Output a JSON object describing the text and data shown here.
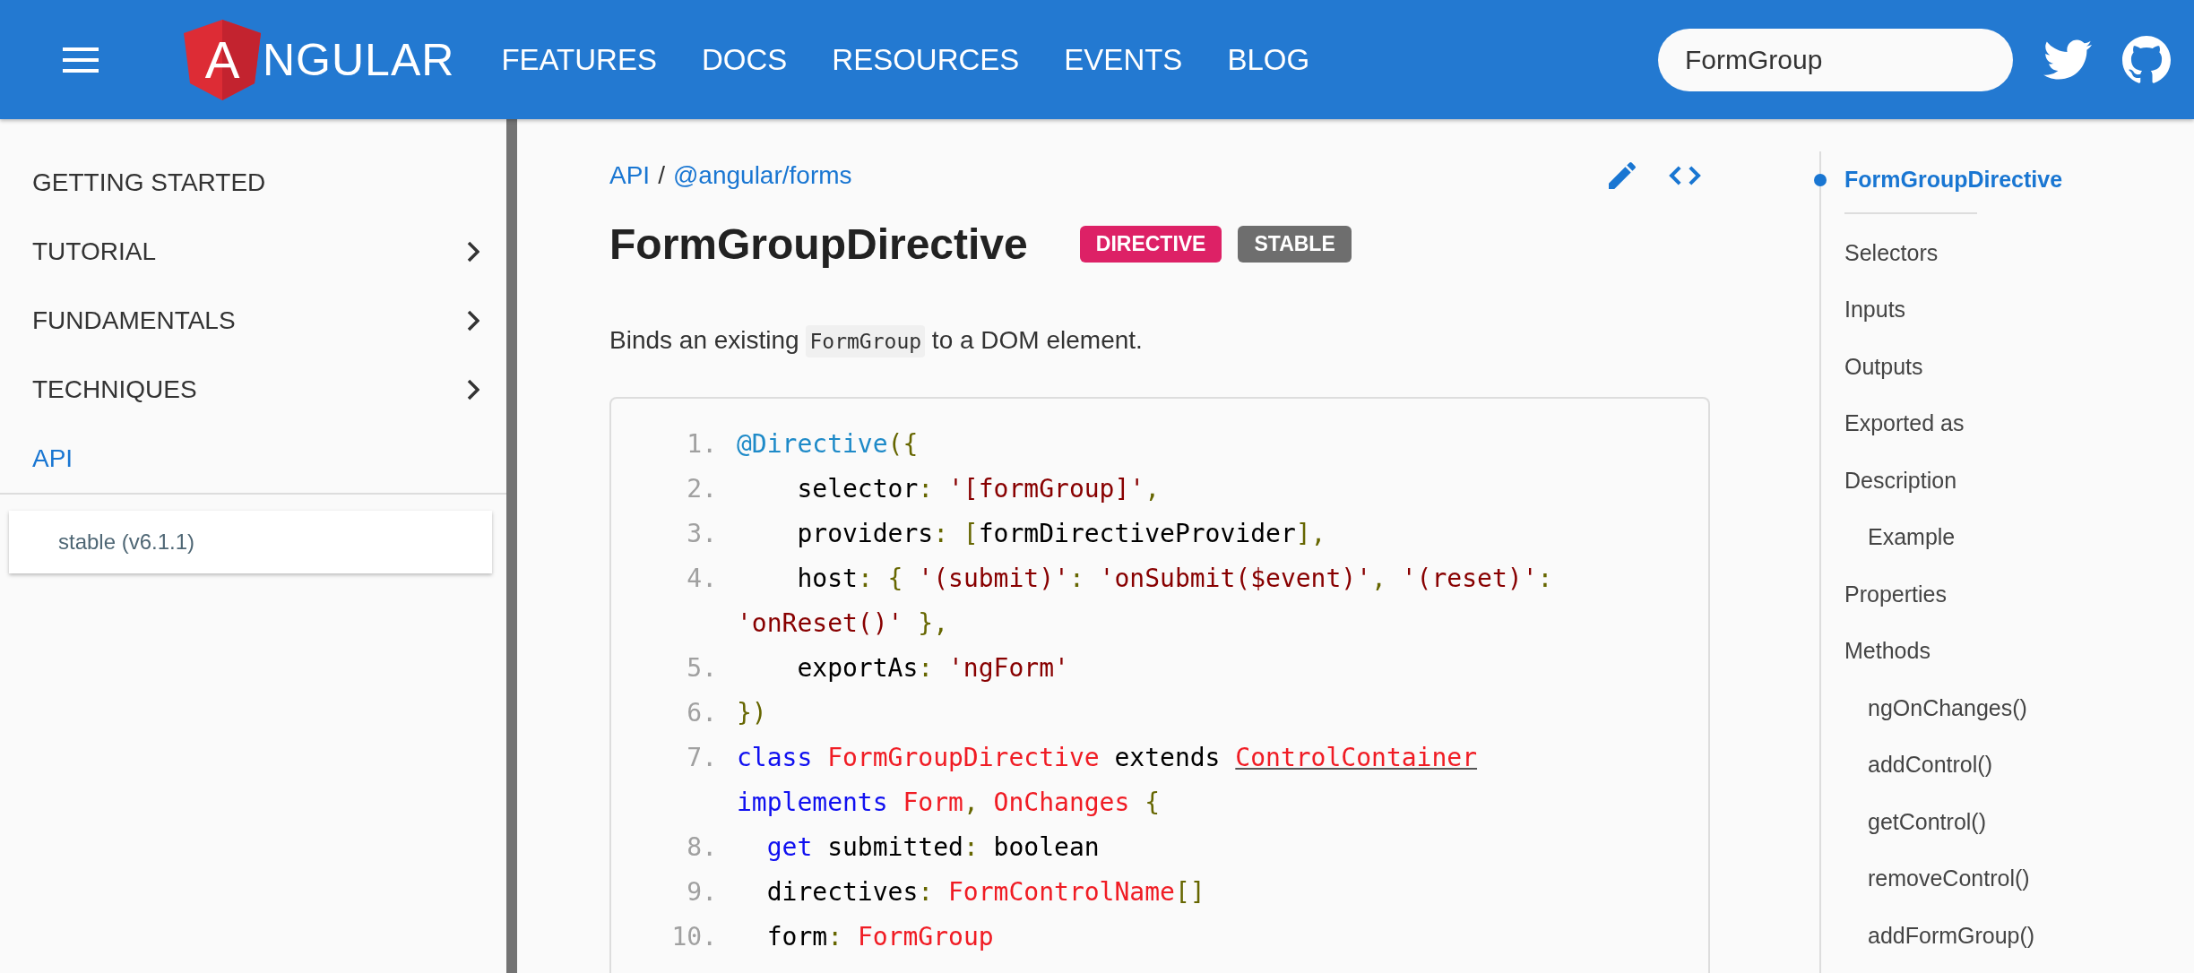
{
  "header": {
    "logo": {
      "shield_letter": "A",
      "wordmark": "NGULAR"
    },
    "nav": [
      {
        "label": "FEATURES"
      },
      {
        "label": "DOCS"
      },
      {
        "label": "RESOURCES"
      },
      {
        "label": "EVENTS"
      },
      {
        "label": "BLOG"
      }
    ],
    "search": {
      "value": "FormGroup"
    }
  },
  "sidebar": {
    "items": [
      {
        "label": "GETTING STARTED",
        "expandable": false,
        "selected": false
      },
      {
        "label": "TUTORIAL",
        "expandable": true,
        "selected": false
      },
      {
        "label": "FUNDAMENTALS",
        "expandable": true,
        "selected": false
      },
      {
        "label": "TECHNIQUES",
        "expandable": true,
        "selected": false
      },
      {
        "label": "API",
        "expandable": false,
        "selected": true
      }
    ],
    "version_select": "stable (v6.1.1)"
  },
  "main": {
    "breadcrumb": {
      "links": [
        "API",
        "@angular/forms"
      ],
      "separator": "/"
    },
    "title": "FormGroupDirective",
    "badges": [
      {
        "label": "DIRECTIVE",
        "color": "#dd2166"
      },
      {
        "label": "STABLE",
        "color": "#6e6e6e"
      }
    ],
    "description": [
      {
        "kind": "text",
        "text": "Binds an existing "
      },
      {
        "kind": "code",
        "text": "FormGroup"
      },
      {
        "kind": "text",
        "text": " to a DOM element."
      }
    ],
    "code_lines": [
      {
        "number": "1.",
        "tokens": [
          {
            "kind": "annotation",
            "text": "@Directive"
          },
          {
            "kind": "punct",
            "text": "({"
          }
        ]
      },
      {
        "number": "2.",
        "tokens": [
          {
            "kind": "plain",
            "text": "    selector"
          },
          {
            "kind": "punct",
            "text": ": "
          },
          {
            "kind": "string",
            "text": "'[formGroup]'"
          },
          {
            "kind": "punct",
            "text": ","
          }
        ]
      },
      {
        "number": "3.",
        "tokens": [
          {
            "kind": "plain",
            "text": "    providers"
          },
          {
            "kind": "punct",
            "text": ": ["
          },
          {
            "kind": "plain",
            "text": "formDirectiveProvider"
          },
          {
            "kind": "punct",
            "text": "],"
          }
        ]
      },
      {
        "number": "4.",
        "tokens": [
          {
            "kind": "plain",
            "text": "    host"
          },
          {
            "kind": "punct",
            "text": ": { "
          },
          {
            "kind": "string",
            "text": "'(submit)'"
          },
          {
            "kind": "punct",
            "text": ": "
          },
          {
            "kind": "string",
            "text": "'onSubmit($event)'"
          },
          {
            "kind": "punct",
            "text": ", "
          },
          {
            "kind": "string",
            "text": "'(reset)'"
          },
          {
            "kind": "punct",
            "text": ": "
          },
          {
            "kind": "string",
            "text": "'onReset()'"
          },
          {
            "kind": "punct",
            "text": " },"
          }
        ]
      },
      {
        "number": "5.",
        "tokens": [
          {
            "kind": "plain",
            "text": "    exportAs"
          },
          {
            "kind": "punct",
            "text": ": "
          },
          {
            "kind": "string",
            "text": "'ngForm'"
          }
        ]
      },
      {
        "number": "6.",
        "tokens": [
          {
            "kind": "punct",
            "text": "})"
          }
        ]
      },
      {
        "number": "7.",
        "tokens": [
          {
            "kind": "keyword",
            "text": "class "
          },
          {
            "kind": "type",
            "text": "FormGroupDirective"
          },
          {
            "kind": "plain",
            "text": " extends "
          },
          {
            "kind": "link",
            "text": "ControlContainer"
          },
          {
            "kind": "keyword",
            "text": " implements "
          },
          {
            "kind": "type",
            "text": "Form"
          },
          {
            "kind": "punct",
            "text": ", "
          },
          {
            "kind": "type",
            "text": "OnChanges"
          },
          {
            "kind": "punct",
            "text": " {"
          }
        ]
      },
      {
        "number": "8.",
        "tokens": [
          {
            "kind": "keyword",
            "text": "  get"
          },
          {
            "kind": "plain",
            "text": " submitted"
          },
          {
            "kind": "punct",
            "text": ": "
          },
          {
            "kind": "plain",
            "text": "boolean"
          }
        ]
      },
      {
        "number": "9.",
        "tokens": [
          {
            "kind": "plain",
            "text": "  directives"
          },
          {
            "kind": "punct",
            "text": ": "
          },
          {
            "kind": "type",
            "text": "FormControlName"
          },
          {
            "kind": "punct",
            "text": "[]"
          }
        ]
      },
      {
        "number": "10.",
        "tokens": [
          {
            "kind": "plain",
            "text": "  form"
          },
          {
            "kind": "punct",
            "text": ": "
          },
          {
            "kind": "type",
            "text": "FormGroup"
          }
        ]
      }
    ]
  },
  "toc": {
    "items": [
      {
        "label": "FormGroupDirective",
        "selected": true
      },
      {
        "label": "Selectors",
        "selected": false
      },
      {
        "label": "Inputs",
        "selected": false
      },
      {
        "label": "Outputs",
        "selected": false
      },
      {
        "label": "Exported as",
        "selected": false
      },
      {
        "label": "Description",
        "selected": false,
        "children": [
          {
            "label": "Example",
            "selected": false
          }
        ]
      },
      {
        "label": "Properties",
        "selected": false
      },
      {
        "label": "Methods",
        "selected": false,
        "children": [
          {
            "label": "ngOnChanges()",
            "selected": false
          },
          {
            "label": "addControl()",
            "selected": false
          },
          {
            "label": "getControl()",
            "selected": false
          },
          {
            "label": "removeControl()",
            "selected": false
          },
          {
            "label": "addFormGroup()",
            "selected": false
          }
        ]
      }
    ]
  }
}
